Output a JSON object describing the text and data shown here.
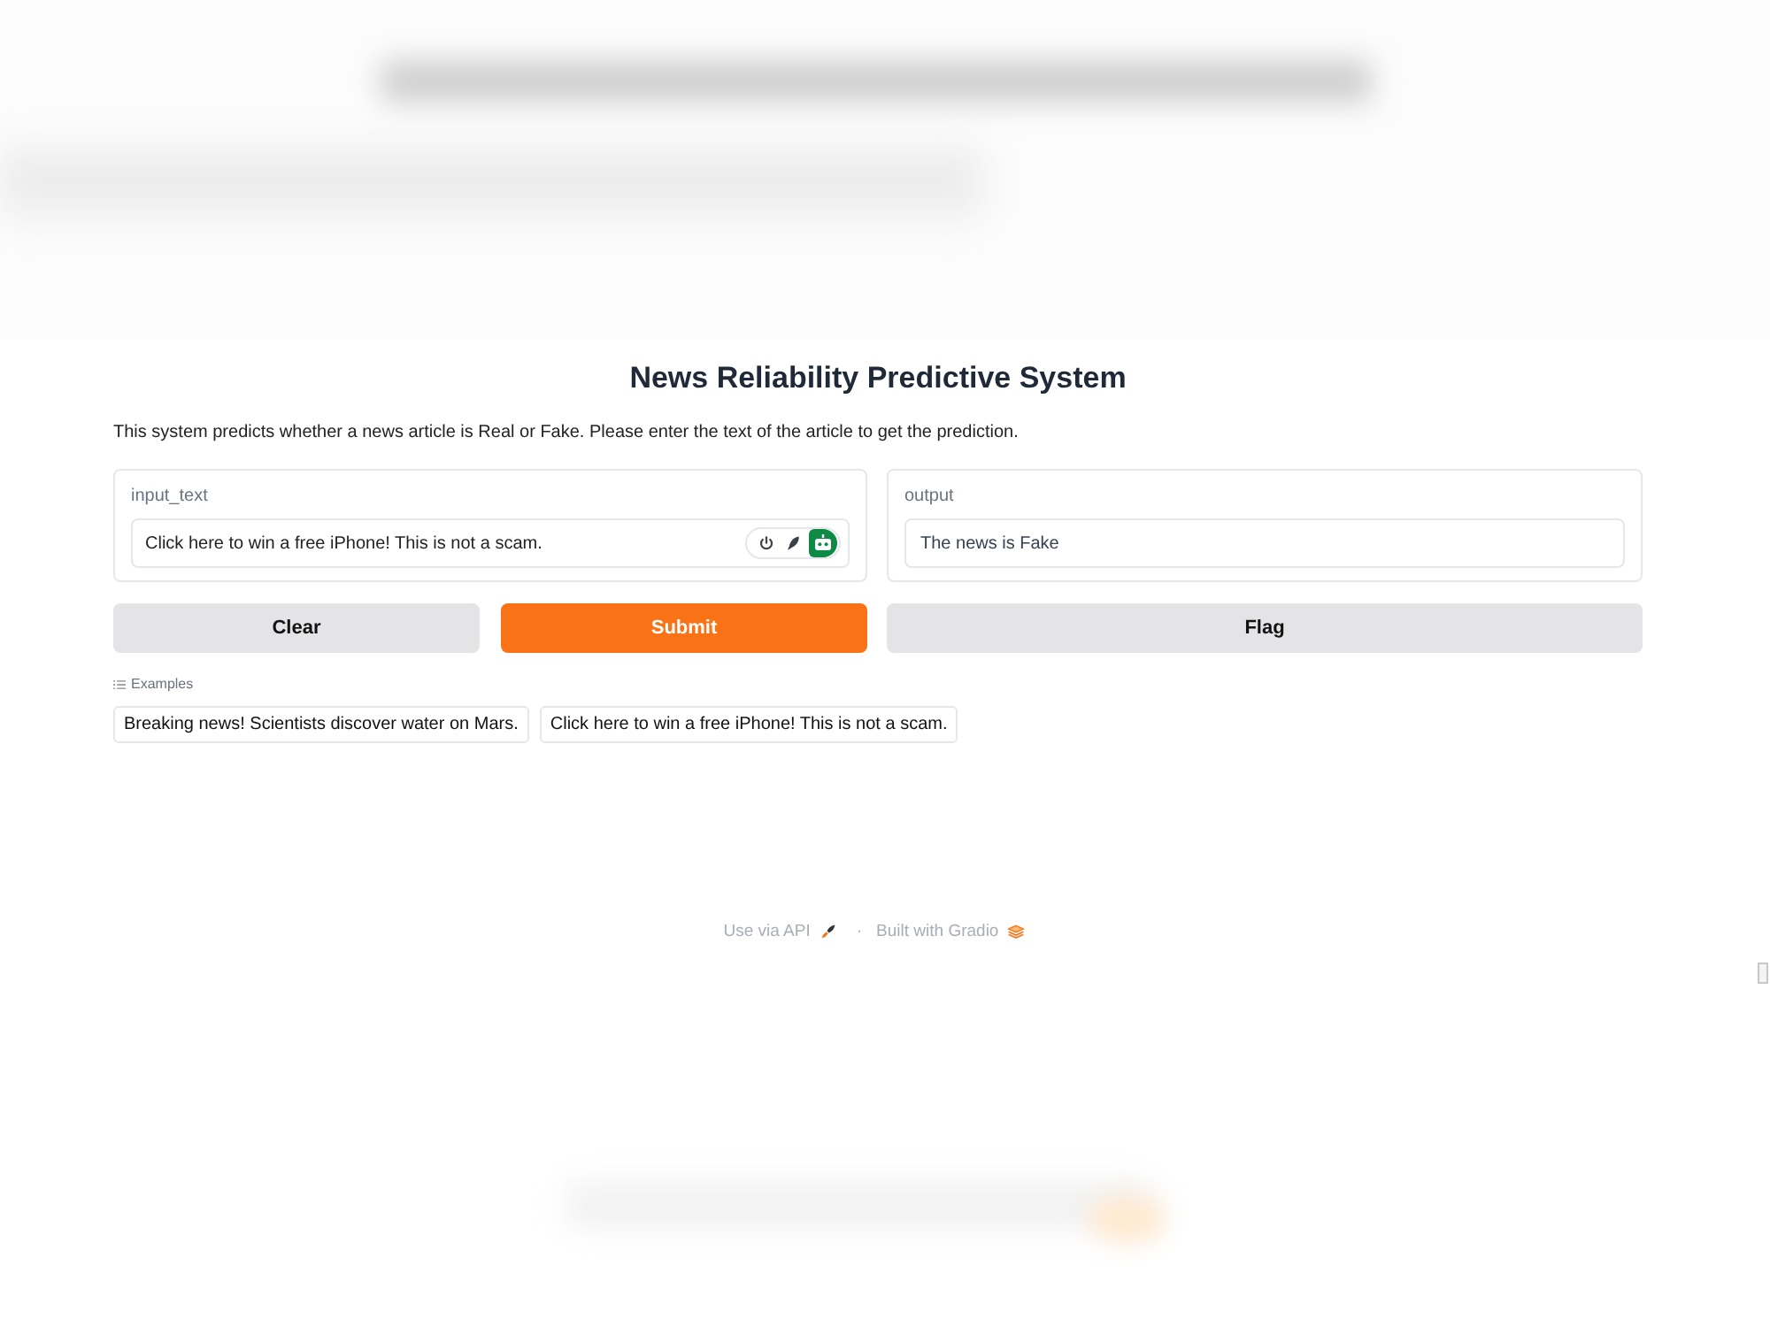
{
  "header": {
    "title": "News Reliability Predictive System",
    "description": "This system predicts whether a news article is Real or Fake. Please enter the text of the article to get the prediction."
  },
  "input": {
    "label": "input_text",
    "value": "Click here to win a free iPhone! This is not a scam.",
    "tools": [
      {
        "selected": false
      },
      {
        "selected": false
      },
      {
        "selected": true
      }
    ]
  },
  "output": {
    "label": "output",
    "value": "The news is Fake"
  },
  "buttons": [
    {
      "label": "Clear",
      "kind": "secondary"
    },
    {
      "label": "Submit",
      "kind": "primary"
    },
    {
      "label": "Flag",
      "kind": "secondary"
    }
  ],
  "examples": {
    "label": "Examples",
    "items": [
      "Breaking news! Scientists discover water on Mars.",
      "Click here to win a free iPhone! This is not a scam."
    ]
  },
  "footer": {
    "links": [
      "Use via API",
      "Built with Gradio"
    ],
    "separator": "·"
  }
}
